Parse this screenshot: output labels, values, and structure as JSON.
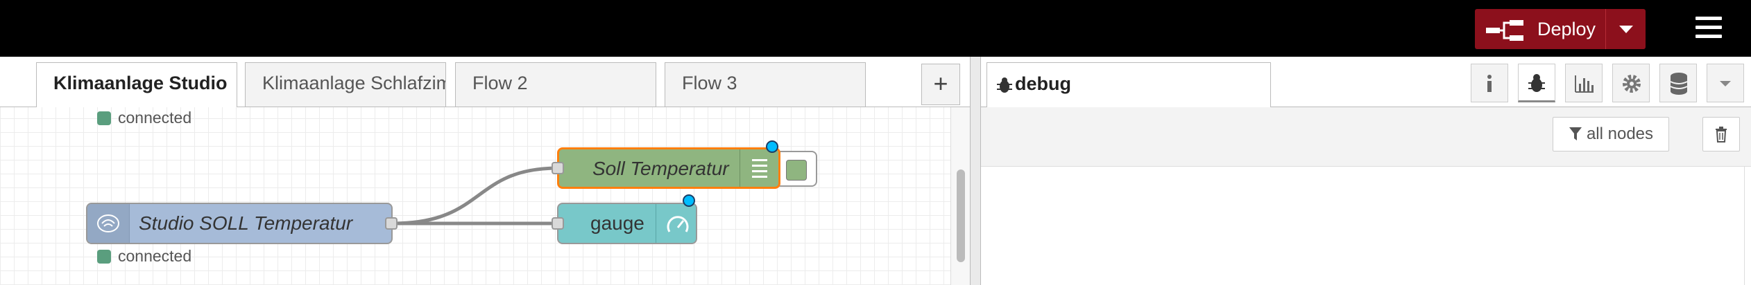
{
  "header": {
    "deploy_label": "Deploy"
  },
  "workspace": {
    "tabs": [
      {
        "label": "Klimaanlage Studio",
        "active": true
      },
      {
        "label": "Klimaanlage Schlafzimmer",
        "active": false
      },
      {
        "label": "Flow 2",
        "active": false
      },
      {
        "label": "Flow 3",
        "active": false
      }
    ],
    "add_tab_label": "+",
    "nodes": {
      "top_status": "connected",
      "soll_node_label": "Soll Temperatur",
      "gauge_node_label": "gauge",
      "studio_node_label": "Studio SOLL Temperatur",
      "studio_status": "connected"
    }
  },
  "sidebar": {
    "active_tab_label": "debug",
    "filter_label": "all nodes"
  },
  "colors": {
    "header_bg": "#000000",
    "deploy_bg": "#8c101c",
    "soll_node": "#8fb580",
    "gauge_node": "#78c8c9",
    "studio_node": "#a6bbd8",
    "selected_outline": "#ff7f0e",
    "changed_indicator": "#00bcff",
    "status_connected": "#5a9e7e"
  }
}
